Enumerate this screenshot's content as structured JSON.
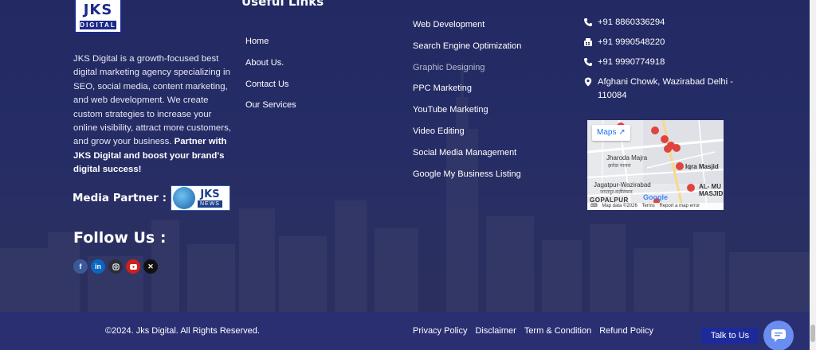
{
  "brand": {
    "logo_main": "JKS",
    "logo_sub": "DIGITAL",
    "about_text": "JKS Digital is a growth-focused best digital marketing agency specializing in SEO, social media, content marketing, and web development. We create custom strategies to increase your online visibility, attract more customers, and grow your business.",
    "about_bold": "Partner with JKS Digital and boost your brand's digital success!"
  },
  "media_partner": {
    "label": "Media Partner :",
    "logo_top": "JKS",
    "logo_bottom": "NEWS"
  },
  "follow": {
    "title": "Follow Us :",
    "icons": [
      "facebook-icon",
      "linkedin-icon",
      "instagram-icon",
      "youtube-icon",
      "x-icon"
    ]
  },
  "useful_links": {
    "title": "Useful Links",
    "column1": [
      "Home",
      "About Us.",
      "Contact Us",
      "Our Services"
    ],
    "column2": [
      "Web Development",
      "Search Engine Optimization",
      "Graphic Designing",
      "PPC Marketing",
      "YouTube Marketing",
      "Video Editing",
      "Social Media Management",
      "Google My Business Listing"
    ]
  },
  "contact": {
    "phone1": "+91 8860336294",
    "phone2": "+91 9990548220",
    "phone3": "+91 9990774918",
    "address": "Afghani Chowk, Wazirabad Delhi - 110084"
  },
  "map": {
    "button": "Maps",
    "labels": {
      "jharoda": "Jharoda Majra",
      "jharoda_hi": "झरोडा माजरा",
      "jagatpur": "Jagatpur-Wazirabad",
      "jagatpur_hi": "जगतपुर-वज़ीराबाद",
      "gopalpur": "GOPALPUR",
      "iqra": "Iqra Masjid",
      "al_mu": "AL- MU",
      "masjid": "MASJID",
      "google": "Google"
    },
    "footer": {
      "data": "Map data ©2026",
      "terms": "Terms",
      "report": "Report a map error"
    }
  },
  "bottom": {
    "copyright": "©2024. Jks Digital. All Rights Reserved.",
    "links": [
      "Privacy Policy",
      "Disclaimer",
      "Term & Condition",
      "Refund Poiicy"
    ]
  },
  "widget": {
    "talk": "Talk to Us"
  },
  "colors": {
    "background": "#232a63",
    "bottom_bar": "#2a2f72",
    "talk_button": "#1d2a9c",
    "chat_button": "#6a8ef0"
  }
}
